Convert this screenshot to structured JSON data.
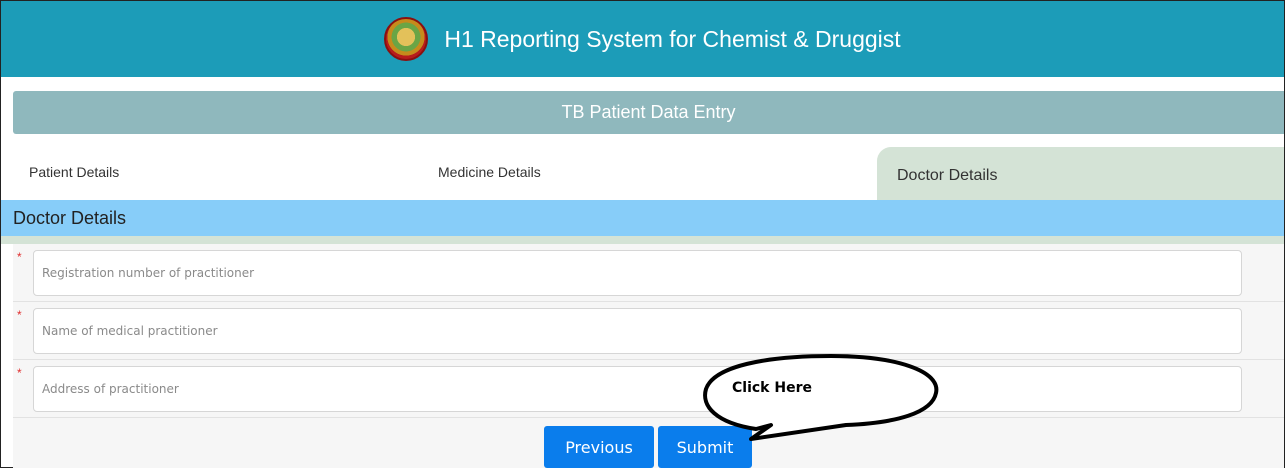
{
  "header": {
    "title": "H1 Reporting System for Chemist & Druggist"
  },
  "subheader": {
    "title": "TB Patient Data Entry"
  },
  "tabs": [
    {
      "label": "Patient Details"
    },
    {
      "label": "Medicine Details"
    },
    {
      "label": "Doctor Details"
    }
  ],
  "section": {
    "title": "Doctor Details"
  },
  "fields": [
    {
      "placeholder": "Registration number of practitioner",
      "required_mark": "*"
    },
    {
      "placeholder": "Name of medical practitioner",
      "required_mark": "*"
    },
    {
      "placeholder": "Address of practitioner",
      "required_mark": "*"
    }
  ],
  "buttons": {
    "previous": "Previous",
    "submit": "Submit"
  },
  "callout": {
    "text": "Click Here"
  },
  "colors": {
    "header": "#1c9cb8",
    "subheader": "#8fb8bd",
    "active_tab": "#d4e3d6",
    "section_bar": "#87cdf9",
    "button": "#0a7dec",
    "required": "#e03030"
  }
}
